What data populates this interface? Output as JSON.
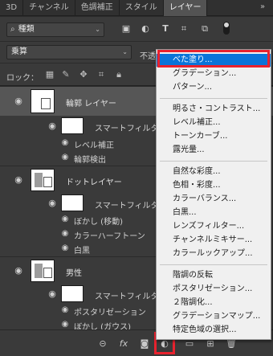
{
  "tabs": [
    "3D",
    "チャンネル",
    "色調補正",
    "スタイル",
    "レイヤー"
  ],
  "active_tab": "レイヤー",
  "tab_menu_icon": "double-chevron-icon",
  "filter": {
    "kind_label": "種類",
    "icons": [
      "pixel-filter-icon",
      "adjustment-filter-icon",
      "type-filter-icon",
      "shape-filter-icon",
      "smart-object-filter-icon"
    ]
  },
  "blend": {
    "mode": "乗算",
    "opacity_label": "不透"
  },
  "lock": {
    "label": "ロック：",
    "icons": [
      "lock-transparent-icon",
      "lock-image-icon",
      "lock-position-icon",
      "lock-artboard-icon",
      "lock-all-icon"
    ]
  },
  "layers": [
    {
      "name": "輪郭 レイヤー",
      "selected": true,
      "filter_label": "スマートフィルター",
      "filters": [
        "レベル補正",
        "輪郭検出"
      ]
    },
    {
      "name": "ドットレイヤー",
      "selected": false,
      "filter_label": "スマートフィルター",
      "filters": [
        "ぼかし (移動)",
        "カラーハーフトーン",
        "白黒"
      ]
    },
    {
      "name": "男性",
      "selected": false,
      "filter_label": "スマートフィルター",
      "filters": [
        "ポスタリゼーション",
        "ぼかし (ガウス)"
      ]
    }
  ],
  "bottom_icons": [
    "link-icon",
    "fx-icon",
    "mask-icon",
    "adjustment-layer-icon",
    "folder-icon",
    "new-layer-icon",
    "trash-icon"
  ],
  "bottom_labels": {
    "link": "⊝",
    "fx": "fx"
  },
  "menu": {
    "groups": [
      [
        "べた塗り...",
        "グラデーション...",
        "パターン..."
      ],
      [
        "明るさ・コントラスト...",
        "レベル補正...",
        "トーンカーブ...",
        "露光量..."
      ],
      [
        "自然な彩度...",
        "色相・彩度...",
        "カラーバランス...",
        "白黒...",
        "レンズフィルター...",
        "チャンネルミキサー...",
        "カラールックアップ..."
      ],
      [
        "階調の反転",
        "ポスタリゼーション...",
        "２階調化...",
        "グラデーションマップ...",
        "特定色域の選択..."
      ]
    ],
    "active_item": "べた塗り..."
  },
  "colors": {
    "highlight": "#e8222e",
    "menu_active": "#0a74d9",
    "panel": "#3a3a3a",
    "selected_row": "#565656"
  }
}
